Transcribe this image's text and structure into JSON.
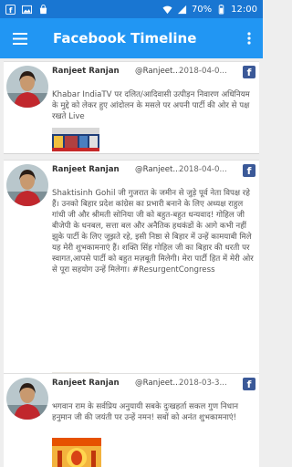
{
  "status_bar": {
    "battery": "70%",
    "time": "12:00"
  },
  "app_bar": {
    "title": "Facebook Timeline"
  },
  "colors": {
    "app_bar": "#2196f3",
    "status_bar": "#1976d2",
    "facebook": "#3b5998"
  },
  "posts": [
    {
      "name": "Ranjeet Ranjan",
      "handle": "@Ranjeet...",
      "date": "2018-04-0...",
      "text": "Khabar IndiaTV पर दलित/आदिवासी उत्पीड़न निवारण अधिनियम के मुद्दे को लेकर हुए आंदोलन के मसले पर अपनी पार्टी की ओर से पक्ष रखते Live"
    },
    {
      "name": "Ranjeet Ranjan",
      "handle": "@Ranjeet...",
      "date": "2018-04-0...",
      "text": "Shaktisinh Gohil जी गुजरात के जमीन से जुड़े पूर्व नेता विपक्ष रहे हैं। उनको बिहार प्रदेश कांग्रेस का प्रभारी बनाने के लिए अध्यक्ष राहुल गांधी जी और श्रीमती सोनिया जी को बहुत-बहुत धन्यवाद! गोहिल जी बीजेपी के धनबल, सत्ता बल और अनैतिक हथकंडों के आगे कभी नहीं झुके पार्टी के लिए जूझते रहे, इसी निष्ठा से बिहार में उन्हें कामयाबी मिले यह मेरी शुभकामनाएं हैं। शक्ति सिंह गोहिल जी का बिहार की धरती पर स्वागत,आपसे पार्टी को बहुत मज़बूती मिलेगी। मेरा पार्टी हित में मेरी ओर से पूरा सहयोग उन्हें मिलेगा। #ResurgentCongress"
    },
    {
      "name": "Ranjeet Ranjan",
      "handle": "@Ranjeet...",
      "date": "2018-03-3...",
      "text": "भगवान राम के सर्वप्रिय अनुयायी सबके दुःखहर्ता सकल गुण निधान हनुमान जी की जयंती पर उन्हें नमन! सबों को अनंत शुभकामनाएं!"
    }
  ]
}
